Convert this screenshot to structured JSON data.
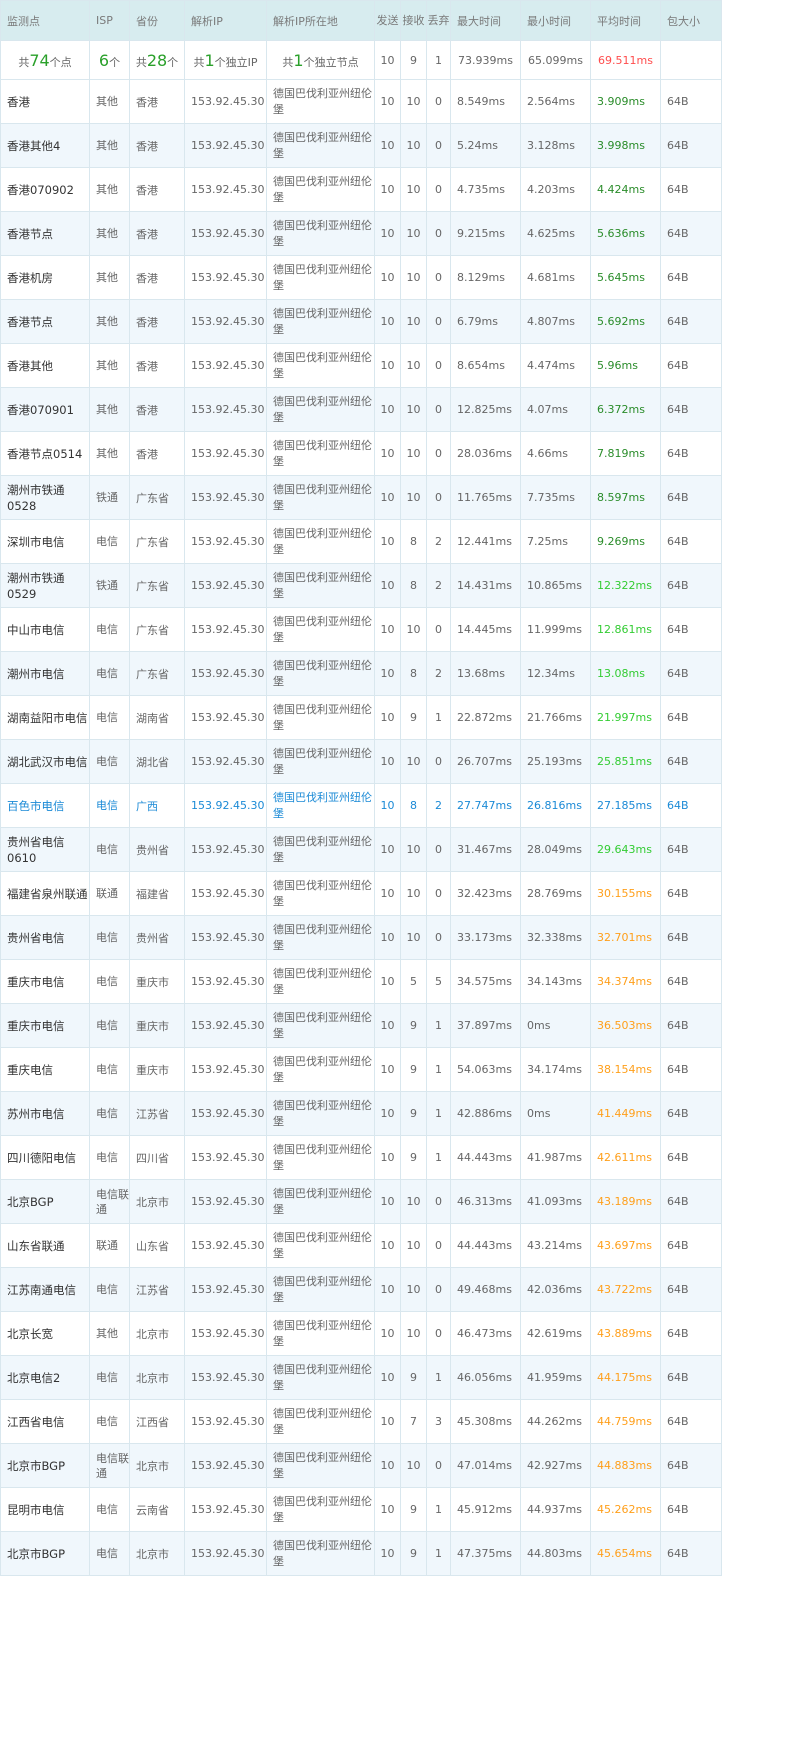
{
  "headers": {
    "monitor": "监测点",
    "isp": "ISP",
    "province": "省份",
    "ip": "解析IP",
    "location": "解析IP所在地",
    "send": "发送",
    "recv": "接收",
    "lost": "丢弃",
    "max": "最大时间",
    "min": "最小时间",
    "avg": "平均时间",
    "size": "包大小"
  },
  "summary": {
    "points_prefix": "共",
    "points": "74",
    "points_suffix": "个点",
    "isp_count": "6",
    "isp_suffix": "个",
    "prov_prefix": "共",
    "prov_count": "28",
    "prov_suffix": "个",
    "ip_prefix": "共",
    "ip_count": "1",
    "ip_suffix": "个独立IP",
    "node_prefix": "共",
    "node_count": "1",
    "node_suffix": "个独立节点",
    "send": "10",
    "recv": "9",
    "lost": "1",
    "max": "73.939ms",
    "min": "65.099ms",
    "avg": "69.511ms"
  },
  "colors": {
    "dark_green": "#2a8c2a",
    "bright_green": "#33cc33",
    "orange": "#ff9f1a",
    "red": "#ff4c4c",
    "highlight_blue": "#1b8ad6"
  },
  "rows": [
    {
      "name": "香港",
      "isp": "其他",
      "province": "香港",
      "ip": "153.92.45.30",
      "location": "德国巴伐利亚州纽伦堡",
      "send": "10",
      "recv": "10",
      "lost": "0",
      "max": "8.549ms",
      "min": "2.564ms",
      "avg": "3.909ms",
      "size": "64B"
    },
    {
      "name": "香港其他4",
      "isp": "其他",
      "province": "香港",
      "ip": "153.92.45.30",
      "location": "德国巴伐利亚州纽伦堡",
      "send": "10",
      "recv": "10",
      "lost": "0",
      "max": "5.24ms",
      "min": "3.128ms",
      "avg": "3.998ms",
      "size": "64B"
    },
    {
      "name": "香港070902",
      "isp": "其他",
      "province": "香港",
      "ip": "153.92.45.30",
      "location": "德国巴伐利亚州纽伦堡",
      "send": "10",
      "recv": "10",
      "lost": "0",
      "max": "4.735ms",
      "min": "4.203ms",
      "avg": "4.424ms",
      "size": "64B"
    },
    {
      "name": "香港节点",
      "isp": "其他",
      "province": "香港",
      "ip": "153.92.45.30",
      "location": "德国巴伐利亚州纽伦堡",
      "send": "10",
      "recv": "10",
      "lost": "0",
      "max": "9.215ms",
      "min": "4.625ms",
      "avg": "5.636ms",
      "size": "64B"
    },
    {
      "name": "香港机房",
      "isp": "其他",
      "province": "香港",
      "ip": "153.92.45.30",
      "location": "德国巴伐利亚州纽伦堡",
      "send": "10",
      "recv": "10",
      "lost": "0",
      "max": "8.129ms",
      "min": "4.681ms",
      "avg": "5.645ms",
      "size": "64B"
    },
    {
      "name": "香港节点",
      "isp": "其他",
      "province": "香港",
      "ip": "153.92.45.30",
      "location": "德国巴伐利亚州纽伦堡",
      "send": "10",
      "recv": "10",
      "lost": "0",
      "max": "6.79ms",
      "min": "4.807ms",
      "avg": "5.692ms",
      "size": "64B"
    },
    {
      "name": "香港其他",
      "isp": "其他",
      "province": "香港",
      "ip": "153.92.45.30",
      "location": "德国巴伐利亚州纽伦堡",
      "send": "10",
      "recv": "10",
      "lost": "0",
      "max": "8.654ms",
      "min": "4.474ms",
      "avg": "5.96ms",
      "size": "64B"
    },
    {
      "name": "香港070901",
      "isp": "其他",
      "province": "香港",
      "ip": "153.92.45.30",
      "location": "德国巴伐利亚州纽伦堡",
      "send": "10",
      "recv": "10",
      "lost": "0",
      "max": "12.825ms",
      "min": "4.07ms",
      "avg": "6.372ms",
      "size": "64B"
    },
    {
      "name": "香港节点0514",
      "isp": "其他",
      "province": "香港",
      "ip": "153.92.45.30",
      "location": "德国巴伐利亚州纽伦堡",
      "send": "10",
      "recv": "10",
      "lost": "0",
      "max": "28.036ms",
      "min": "4.66ms",
      "avg": "7.819ms",
      "size": "64B"
    },
    {
      "name": "潮州市铁通0528",
      "isp": "铁通",
      "province": "广东省",
      "ip": "153.92.45.30",
      "location": "德国巴伐利亚州纽伦堡",
      "send": "10",
      "recv": "10",
      "lost": "0",
      "max": "11.765ms",
      "min": "7.735ms",
      "avg": "8.597ms",
      "size": "64B"
    },
    {
      "name": "深圳市电信",
      "isp": "电信",
      "province": "广东省",
      "ip": "153.92.45.30",
      "location": "德国巴伐利亚州纽伦堡",
      "send": "10",
      "recv": "8",
      "lost": "2",
      "max": "12.441ms",
      "min": "7.25ms",
      "avg": "9.269ms",
      "size": "64B"
    },
    {
      "name": "潮州市铁通0529",
      "isp": "铁通",
      "province": "广东省",
      "ip": "153.92.45.30",
      "location": "德国巴伐利亚州纽伦堡",
      "send": "10",
      "recv": "8",
      "lost": "2",
      "max": "14.431ms",
      "min": "10.865ms",
      "avg": "12.322ms",
      "size": "64B"
    },
    {
      "name": "中山市电信",
      "isp": "电信",
      "province": "广东省",
      "ip": "153.92.45.30",
      "location": "德国巴伐利亚州纽伦堡",
      "send": "10",
      "recv": "10",
      "lost": "0",
      "max": "14.445ms",
      "min": "11.999ms",
      "avg": "12.861ms",
      "size": "64B"
    },
    {
      "name": "潮州市电信",
      "isp": "电信",
      "province": "广东省",
      "ip": "153.92.45.30",
      "location": "德国巴伐利亚州纽伦堡",
      "send": "10",
      "recv": "8",
      "lost": "2",
      "max": "13.68ms",
      "min": "12.34ms",
      "avg": "13.08ms",
      "size": "64B"
    },
    {
      "name": "湖南益阳市电信",
      "isp": "电信",
      "province": "湖南省",
      "ip": "153.92.45.30",
      "location": "德国巴伐利亚州纽伦堡",
      "send": "10",
      "recv": "9",
      "lost": "1",
      "max": "22.872ms",
      "min": "21.766ms",
      "avg": "21.997ms",
      "size": "64B"
    },
    {
      "name": "湖北武汉市电信",
      "isp": "电信",
      "province": "湖北省",
      "ip": "153.92.45.30",
      "location": "德国巴伐利亚州纽伦堡",
      "send": "10",
      "recv": "10",
      "lost": "0",
      "max": "26.707ms",
      "min": "25.193ms",
      "avg": "25.851ms",
      "size": "64B"
    },
    {
      "name": "百色市电信",
      "isp": "电信",
      "province": "广西",
      "ip": "153.92.45.30",
      "location": "德国巴伐利亚州纽伦堡",
      "send": "10",
      "recv": "8",
      "lost": "2",
      "max": "27.747ms",
      "min": "26.816ms",
      "avg": "27.185ms",
      "size": "64B",
      "highlight": true
    },
    {
      "name": "贵州省电信0610",
      "isp": "电信",
      "province": "贵州省",
      "ip": "153.92.45.30",
      "location": "德国巴伐利亚州纽伦堡",
      "send": "10",
      "recv": "10",
      "lost": "0",
      "max": "31.467ms",
      "min": "28.049ms",
      "avg": "29.643ms",
      "size": "64B"
    },
    {
      "name": "福建省泉州联通",
      "isp": "联通",
      "province": "福建省",
      "ip": "153.92.45.30",
      "location": "德国巴伐利亚州纽伦堡",
      "send": "10",
      "recv": "10",
      "lost": "0",
      "max": "32.423ms",
      "min": "28.769ms",
      "avg": "30.155ms",
      "size": "64B"
    },
    {
      "name": "贵州省电信",
      "isp": "电信",
      "province": "贵州省",
      "ip": "153.92.45.30",
      "location": "德国巴伐利亚州纽伦堡",
      "send": "10",
      "recv": "10",
      "lost": "0",
      "max": "33.173ms",
      "min": "32.338ms",
      "avg": "32.701ms",
      "size": "64B"
    },
    {
      "name": "重庆市电信",
      "isp": "电信",
      "province": "重庆市",
      "ip": "153.92.45.30",
      "location": "德国巴伐利亚州纽伦堡",
      "send": "10",
      "recv": "5",
      "lost": "5",
      "max": "34.575ms",
      "min": "34.143ms",
      "avg": "34.374ms",
      "size": "64B"
    },
    {
      "name": "重庆市电信",
      "isp": "电信",
      "province": "重庆市",
      "ip": "153.92.45.30",
      "location": "德国巴伐利亚州纽伦堡",
      "send": "10",
      "recv": "9",
      "lost": "1",
      "max": "37.897ms",
      "min": "0ms",
      "avg": "36.503ms",
      "size": "64B"
    },
    {
      "name": "重庆电信",
      "isp": "电信",
      "province": "重庆市",
      "ip": "153.92.45.30",
      "location": "德国巴伐利亚州纽伦堡",
      "send": "10",
      "recv": "9",
      "lost": "1",
      "max": "54.063ms",
      "min": "34.174ms",
      "avg": "38.154ms",
      "size": "64B"
    },
    {
      "name": "苏州市电信",
      "isp": "电信",
      "province": "江苏省",
      "ip": "153.92.45.30",
      "location": "德国巴伐利亚州纽伦堡",
      "send": "10",
      "recv": "9",
      "lost": "1",
      "max": "42.886ms",
      "min": "0ms",
      "avg": "41.449ms",
      "size": "64B"
    },
    {
      "name": "四川德阳电信",
      "isp": "电信",
      "province": "四川省",
      "ip": "153.92.45.30",
      "location": "德国巴伐利亚州纽伦堡",
      "send": "10",
      "recv": "9",
      "lost": "1",
      "max": "44.443ms",
      "min": "41.987ms",
      "avg": "42.611ms",
      "size": "64B"
    },
    {
      "name": "北京BGP",
      "isp": "电信联通",
      "province": "北京市",
      "ip": "153.92.45.30",
      "location": "德国巴伐利亚州纽伦堡",
      "send": "10",
      "recv": "10",
      "lost": "0",
      "max": "46.313ms",
      "min": "41.093ms",
      "avg": "43.189ms",
      "size": "64B"
    },
    {
      "name": "山东省联通",
      "isp": "联通",
      "province": "山东省",
      "ip": "153.92.45.30",
      "location": "德国巴伐利亚州纽伦堡",
      "send": "10",
      "recv": "10",
      "lost": "0",
      "max": "44.443ms",
      "min": "43.214ms",
      "avg": "43.697ms",
      "size": "64B"
    },
    {
      "name": "江苏南通电信",
      "isp": "电信",
      "province": "江苏省",
      "ip": "153.92.45.30",
      "location": "德国巴伐利亚州纽伦堡",
      "send": "10",
      "recv": "10",
      "lost": "0",
      "max": "49.468ms",
      "min": "42.036ms",
      "avg": "43.722ms",
      "size": "64B"
    },
    {
      "name": "北京长宽",
      "isp": "其他",
      "province": "北京市",
      "ip": "153.92.45.30",
      "location": "德国巴伐利亚州纽伦堡",
      "send": "10",
      "recv": "10",
      "lost": "0",
      "max": "46.473ms",
      "min": "42.619ms",
      "avg": "43.889ms",
      "size": "64B"
    },
    {
      "name": "北京电信2",
      "isp": "电信",
      "province": "北京市",
      "ip": "153.92.45.30",
      "location": "德国巴伐利亚州纽伦堡",
      "send": "10",
      "recv": "9",
      "lost": "1",
      "max": "46.056ms",
      "min": "41.959ms",
      "avg": "44.175ms",
      "size": "64B"
    },
    {
      "name": "江西省电信",
      "isp": "电信",
      "province": "江西省",
      "ip": "153.92.45.30",
      "location": "德国巴伐利亚州纽伦堡",
      "send": "10",
      "recv": "7",
      "lost": "3",
      "max": "45.308ms",
      "min": "44.262ms",
      "avg": "44.759ms",
      "size": "64B"
    },
    {
      "name": "北京市BGP",
      "isp": "电信联通",
      "province": "北京市",
      "ip": "153.92.45.30",
      "location": "德国巴伐利亚州纽伦堡",
      "send": "10",
      "recv": "10",
      "lost": "0",
      "max": "47.014ms",
      "min": "42.927ms",
      "avg": "44.883ms",
      "size": "64B"
    },
    {
      "name": "昆明市电信",
      "isp": "电信",
      "province": "云南省",
      "ip": "153.92.45.30",
      "location": "德国巴伐利亚州纽伦堡",
      "send": "10",
      "recv": "9",
      "lost": "1",
      "max": "45.912ms",
      "min": "44.937ms",
      "avg": "45.262ms",
      "size": "64B"
    },
    {
      "name": "北京市BGP",
      "isp": "电信",
      "province": "北京市",
      "ip": "153.92.45.30",
      "location": "德国巴伐利亚州纽伦堡",
      "send": "10",
      "recv": "9",
      "lost": "1",
      "max": "47.375ms",
      "min": "44.803ms",
      "avg": "45.654ms",
      "size": "64B"
    }
  ]
}
